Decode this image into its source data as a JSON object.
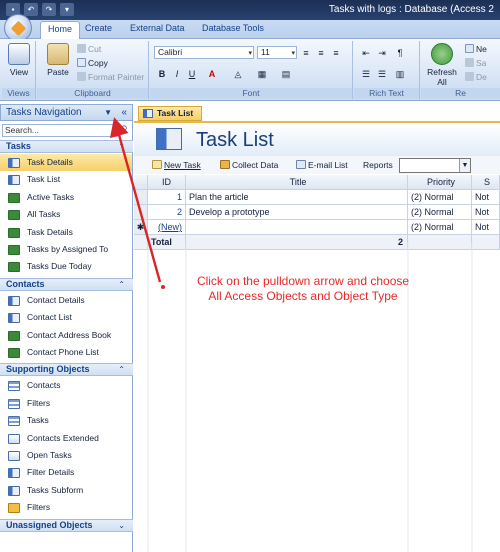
{
  "titlebar": {
    "title": "Tasks with logs : Database (Access 2"
  },
  "tabs": [
    {
      "label": "Home"
    },
    {
      "label": "Create"
    },
    {
      "label": "External Data"
    },
    {
      "label": "Database Tools"
    }
  ],
  "ribbon": {
    "views": {
      "view_label": "View",
      "group_label": "Views"
    },
    "clipboard": {
      "paste_label": "Paste",
      "cut_label": "Cut",
      "copy_label": "Copy",
      "format_painter_label": "Format Painter",
      "group_label": "Clipboard"
    },
    "font": {
      "font_name": "Calibri",
      "font_size": "11",
      "group_label": "Font"
    },
    "rich_text": {
      "group_label": "Rich Text"
    },
    "records": {
      "refresh_label": "Refresh",
      "refresh_sub": "All",
      "new_label": "Ne",
      "save_label": "Sa",
      "delete_label": "De",
      "group_label": "Re"
    }
  },
  "nav": {
    "title": "Tasks Navigation",
    "search_placeholder": "Search...",
    "sections": [
      {
        "title": "Tasks",
        "items": [
          {
            "label": "Task Details",
            "icon": "form",
            "selected": true
          },
          {
            "label": "Task List",
            "icon": "form"
          },
          {
            "label": "Active Tasks",
            "icon": "report"
          },
          {
            "label": "All Tasks",
            "icon": "report"
          },
          {
            "label": "Task Details",
            "icon": "report"
          },
          {
            "label": "Tasks by Assigned To",
            "icon": "report"
          },
          {
            "label": "Tasks Due Today",
            "icon": "report"
          }
        ]
      },
      {
        "title": "Contacts",
        "items": [
          {
            "label": "Contact Details",
            "icon": "form"
          },
          {
            "label": "Contact List",
            "icon": "form"
          },
          {
            "label": "Contact Address Book",
            "icon": "report"
          },
          {
            "label": "Contact Phone List",
            "icon": "report"
          }
        ]
      },
      {
        "title": "Supporting Objects",
        "items": [
          {
            "label": "Contacts",
            "icon": "table"
          },
          {
            "label": "Filters",
            "icon": "table"
          },
          {
            "label": "Tasks",
            "icon": "table"
          },
          {
            "label": "Contacts Extended",
            "icon": "query"
          },
          {
            "label": "Open Tasks",
            "icon": "query"
          },
          {
            "label": "Filter Details",
            "icon": "form"
          },
          {
            "label": "Tasks Subform",
            "icon": "form"
          },
          {
            "label": "Filters",
            "icon": "macro"
          }
        ]
      },
      {
        "title": "Unassigned Objects",
        "items": []
      }
    ]
  },
  "document": {
    "tab_label": "Task List",
    "form_title": "Task List",
    "toolbar": {
      "new_task": "New Task",
      "collect_data": "Collect Data",
      "email_list": "E-mail List",
      "reports": "Reports"
    },
    "grid": {
      "headers": [
        "ID",
        "Title",
        "Priority",
        "S"
      ],
      "rows": [
        {
          "id": "1",
          "title": "Plan the article",
          "priority": "(2) Normal",
          "status": "Not"
        },
        {
          "id": "2",
          "title": "Develop a prototype",
          "priority": "(2) Normal",
          "status": "Not"
        },
        {
          "id": "(New)",
          "title": "",
          "priority": "(2) Normal",
          "status": "Not"
        }
      ],
      "total_label": "Total",
      "total_value": "2",
      "new_row_marker": "✱"
    }
  },
  "annotation": {
    "line1": "Click on the pulldown arrow and choose",
    "line2": "All Access Objects and Object Type",
    "color": "#e8282a"
  },
  "colors": {
    "accent": "#15428b",
    "selection": "#f6cf6a",
    "annotation": "#e8282a"
  }
}
